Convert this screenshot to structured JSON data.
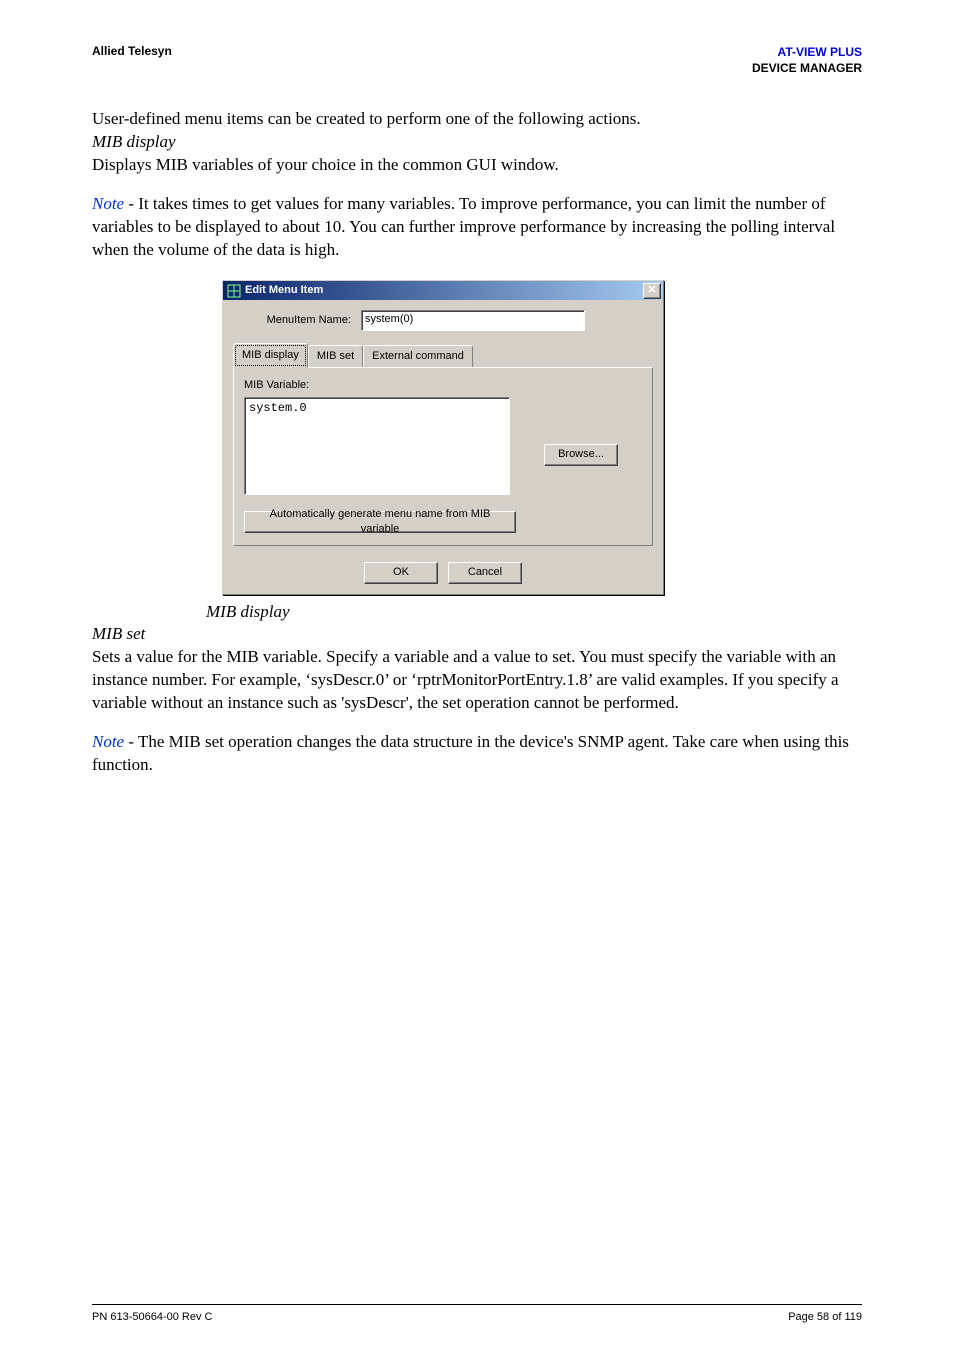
{
  "header": {
    "left": "Allied Telesyn",
    "right_line1": "AT-VIEW PLUS",
    "right_line2": "DEVICE MANAGER"
  },
  "intro": "User-defined menu items can be created to perform one of the following actions.",
  "mib_display": {
    "heading": "MIB display",
    "para": "Displays MIB variables of your choice in the common GUI window.",
    "note_label": "Note",
    "note_rest": " - It takes times to get values for many variables. To improve performance, you can limit the number of variables to be displayed to about 10. You can further improve performance by increasing the polling interval when the volume of the data is high."
  },
  "dialog": {
    "title": "Edit Menu Item",
    "menuitem_label": "MenuItem Name:",
    "menuitem_value": "system(0)",
    "tabs": {
      "mib_display": "MIB display",
      "mib_set": "MIB set",
      "external": "External command"
    },
    "var_label": "MIB Variable:",
    "var_value": "system.0",
    "browse": "Browse...",
    "generate": "Automatically generate menu name from MIB variable",
    "ok": "OK",
    "cancel": "Cancel",
    "caption": "MIB display"
  },
  "mib_set": {
    "heading": "MIB set",
    "para": "Sets a value for the MIB variable. Specify a variable and a value to set. You must specify the variable with an instance number. For example, ‘sysDescr.0’ or ‘rptrMonitorPortEntry.1.8’ are valid examples. If you specify a variable without an instance such as 'sysDescr', the set operation cannot be performed.",
    "note_label": "Note",
    "note_rest": " - The MIB set operation changes the data structure in the device's SNMP agent. Take care when using this function."
  },
  "footer": {
    "left": "PN 613-50664-00 Rev C",
    "right": "Page 58 of 119"
  }
}
